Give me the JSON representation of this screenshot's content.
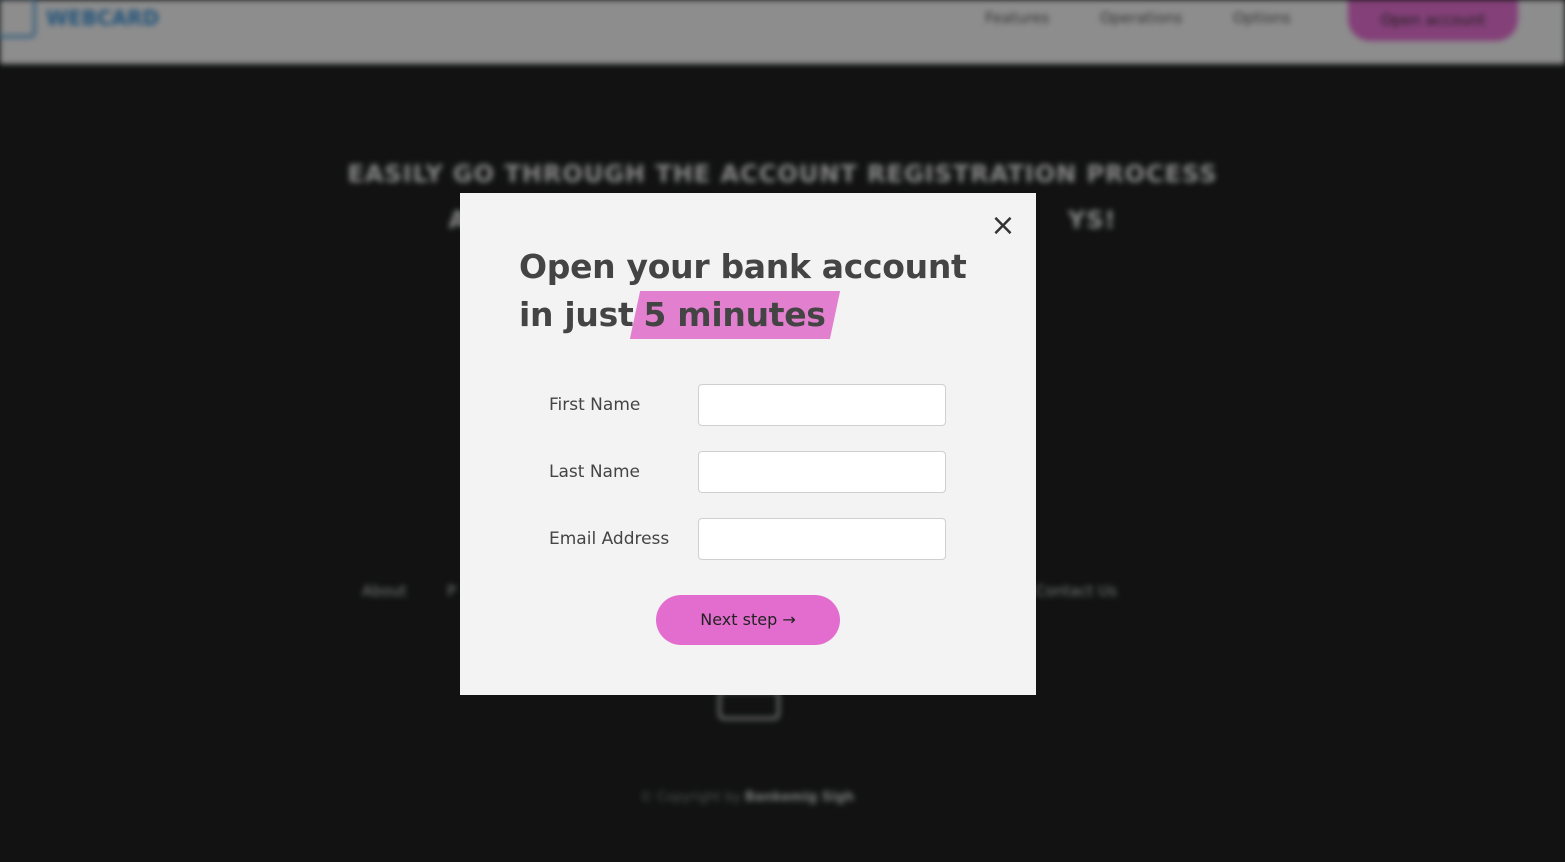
{
  "background": {
    "logo_text": "WEBCARD",
    "nav": [
      "Features",
      "Operations",
      "Options"
    ],
    "open_account_label": "Open account",
    "headline_line1": "EASILY GO THROUGH THE ACCOUNT REGISTRATION PROCESS",
    "headline_line2": "AN",
    "headline_line2_end": "YS!",
    "footer_links": [
      "About",
      "P",
      "Contact Us"
    ],
    "copyright_prefix": "© Copyright by",
    "copyright_name": "Bankemig Sigh"
  },
  "modal": {
    "close_label": "×",
    "title_line1": "Open your bank account",
    "title_line2_prefix": "in just",
    "title_highlight": "5 minutes",
    "fields": [
      {
        "label": "First Name",
        "value": "",
        "placeholder": ""
      },
      {
        "label": "Last Name",
        "value": "",
        "placeholder": ""
      },
      {
        "label": "Email Address",
        "value": "",
        "placeholder": ""
      }
    ],
    "next_label": "Next step →"
  },
  "colors": {
    "accent": "#e36dcf",
    "highlight": "#e27fcf",
    "modal_bg": "#f3f3f3",
    "page_bg": "#1f2021"
  }
}
